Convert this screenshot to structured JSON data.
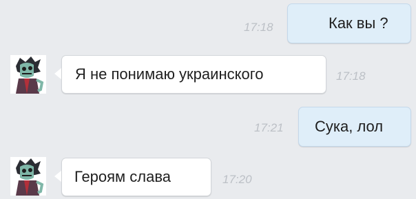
{
  "messages": [
    {
      "direction": "outgoing",
      "text": "Как вы ?",
      "time": "17:18"
    },
    {
      "direction": "incoming",
      "text": "Я не понимаю украинского",
      "time": "17:18"
    },
    {
      "direction": "outgoing",
      "text": "Сука, лол",
      "time": "17:21"
    },
    {
      "direction": "incoming",
      "text": "Героям слава",
      "time": "17:20"
    }
  ],
  "colors": {
    "background": "#e9ebee",
    "outgoing_bubble": "#dfeef9",
    "incoming_bubble": "#ffffff",
    "timestamp": "#bcc0c6",
    "text": "#1e1e1e"
  },
  "icons": {
    "avatar": "zombie-character-avatar"
  }
}
